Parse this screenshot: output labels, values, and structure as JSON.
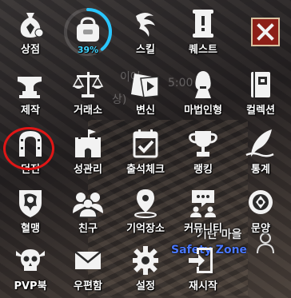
{
  "colors": {
    "icon_fill": "#f2f2f2",
    "icon_dark": "#2a2a2a",
    "progress_accent": "#29c6ff",
    "close_bg": "#8c1f17",
    "highlight": "#e01616",
    "safe_zone": "#4a78ff"
  },
  "menu": {
    "items": [
      {
        "label": "상점",
        "icon": "money-bag-icon"
      },
      {
        "label": "39%",
        "icon": "bag-progress-icon",
        "progress": 0.39
      },
      {
        "label": "스킬",
        "icon": "skill-swirl-icon"
      },
      {
        "label": "퀘스트",
        "icon": "quest-scroll-icon"
      },
      {
        "label": "",
        "icon": "close-icon"
      },
      {
        "label": "제작",
        "icon": "anvil-icon"
      },
      {
        "label": "거래소",
        "icon": "scales-icon"
      },
      {
        "label": "변신",
        "icon": "transform-cards-icon"
      },
      {
        "label": "마법인형",
        "icon": "magic-doll-icon"
      },
      {
        "label": "컬렉션",
        "icon": "collection-book-icon"
      },
      {
        "label": "던전",
        "icon": "dungeon-gate-icon"
      },
      {
        "label": "성관리",
        "icon": "castle-icon"
      },
      {
        "label": "출석체크",
        "icon": "calendar-check-icon"
      },
      {
        "label": "랭킹",
        "icon": "trophy-icon"
      },
      {
        "label": "통계",
        "icon": "quill-icon"
      },
      {
        "label": "혈맹",
        "icon": "lion-shield-icon"
      },
      {
        "label": "친구",
        "icon": "friends-icon"
      },
      {
        "label": "기억장소",
        "icon": "location-pin-icon"
      },
      {
        "label": "커뮤니티",
        "icon": "chat-community-icon"
      },
      {
        "label": "문양",
        "icon": "emblem-icon"
      },
      {
        "label": "PVP북",
        "icon": "pvp-skull-icon"
      },
      {
        "label": "우편함",
        "icon": "mail-icon"
      },
      {
        "label": "설정",
        "icon": "gear-icon"
      },
      {
        "label": "재시작",
        "icon": "restart-door-icon"
      }
    ]
  },
  "background": {
    "village_label": "기란 마을",
    "safe_zone_label": "Safety Zone",
    "faded_text_1": "이어",
    "faded_text_2": "5:00",
    "faded_text_3": "상)"
  }
}
